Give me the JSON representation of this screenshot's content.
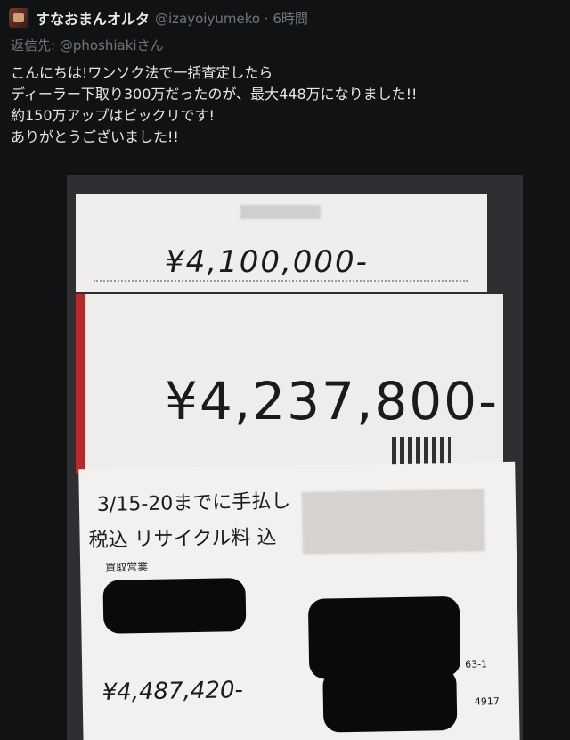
{
  "post": {
    "display_name": "すなおまんオルタ",
    "handle_time": "@izayoiyumeko · 6時間",
    "reply_prefix": "返信先:",
    "reply_to": "@phoshiakiさん",
    "lines": [
      "こんにちは!ワンソク法で一括査定したら",
      "ディーラー下取り300万だったのが、最大448万になりました!!",
      "約150万アップはビックリです!",
      "ありがとうございました!!"
    ]
  },
  "photo": {
    "card1_amount": "¥4,100,000-",
    "card2_amount": "¥4,237,800-",
    "card3_line1": "3/15-20までに手払し",
    "card3_line2": "税込 リサイクル料 込",
    "card3_label": "買取営業",
    "card3_amount": "¥4,487,420-",
    "card3_code1": "63-1",
    "card3_code2": "4917"
  }
}
